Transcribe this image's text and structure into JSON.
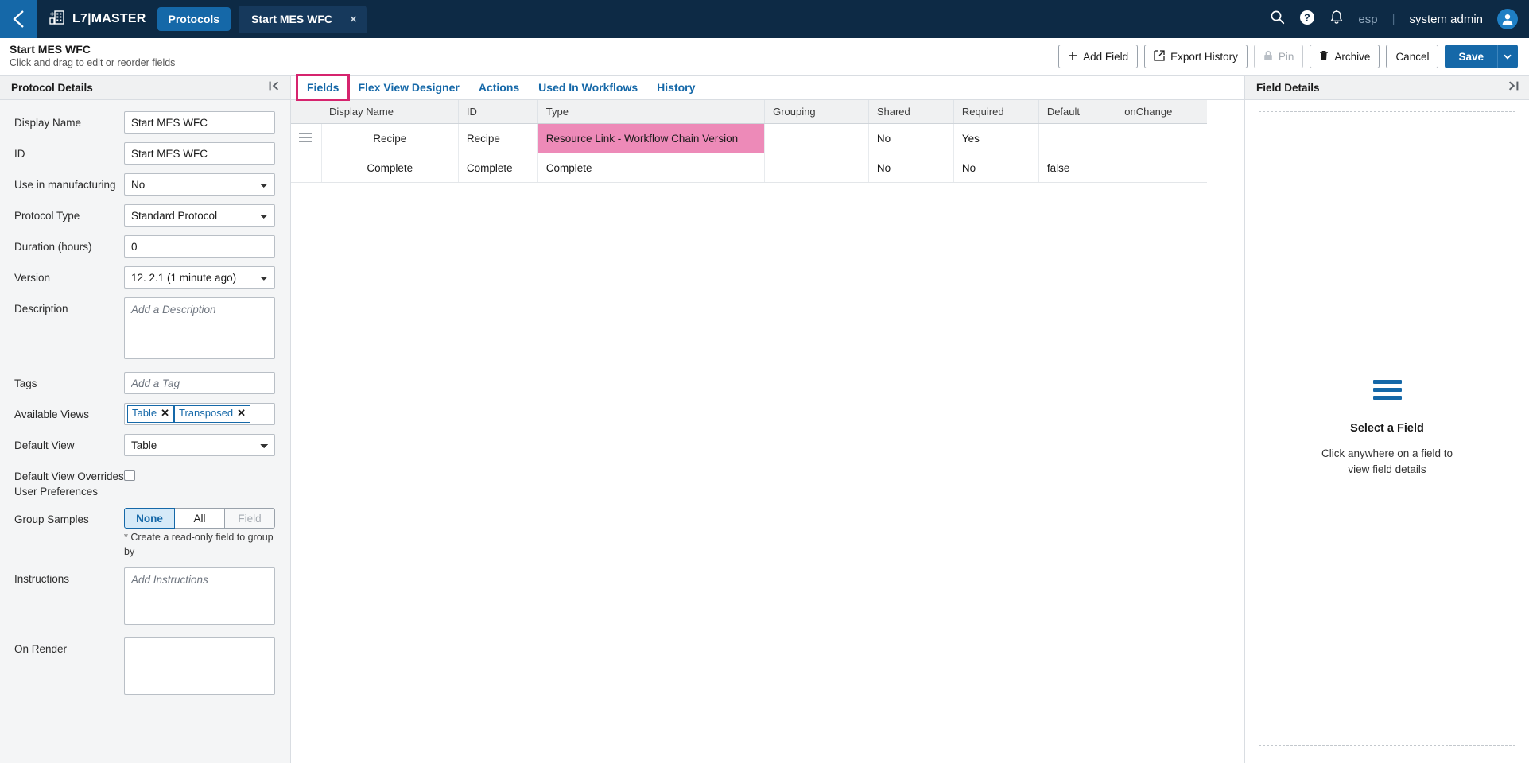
{
  "topbar": {
    "back_icon": "chevron-left-icon",
    "brand_icon": "building-add-icon",
    "brand_label": "L7|MASTER",
    "nav_pill_label": "Protocols",
    "open_tab_label": "Start MES WFC",
    "open_tab_close": "×",
    "search_icon": "search-icon",
    "help_icon": "help-circle-icon",
    "notifications_icon": "bell-icon",
    "org_label": "esp",
    "divider": "|",
    "user_name": "system admin",
    "avatar_icon": "user-avatar-icon"
  },
  "pagehead": {
    "title": "Start MES WFC",
    "subtitle": "Click and drag to edit or reorder fields",
    "actions": [
      {
        "label": "Add Field",
        "icon": "plus-icon",
        "disabled": false
      },
      {
        "label": "Export History",
        "icon": "external-link-icon",
        "disabled": false
      },
      {
        "label": "Pin",
        "icon": "lock-icon",
        "disabled": true
      },
      {
        "label": "Archive",
        "icon": "trash-icon",
        "disabled": false
      },
      {
        "label": "Cancel",
        "icon": "",
        "disabled": false
      }
    ],
    "save_label": "Save",
    "save_caret_icon": "chevron-down-icon"
  },
  "sidebar": {
    "panel_title": "Protocol Details",
    "collapse_icon": "collapse-left-icon",
    "fields": {
      "display_name": {
        "label": "Display Name",
        "value": "Start MES WFC"
      },
      "id": {
        "label": "ID",
        "value": "Start MES WFC"
      },
      "use_in_manufacturing": {
        "label": "Use in manufacturing",
        "value": "No"
      },
      "protocol_type": {
        "label": "Protocol Type",
        "value": "Standard Protocol"
      },
      "duration": {
        "label": "Duration (hours)",
        "value": "0"
      },
      "version": {
        "label": "Version",
        "value": "12. 2.1 (1 minute ago)"
      },
      "description": {
        "label": "Description",
        "value": "",
        "placeholder": "Add a Description"
      },
      "tags": {
        "label": "Tags",
        "value": "",
        "placeholder": "Add a Tag"
      },
      "available_views": {
        "label": "Available Views",
        "tags": [
          "Table",
          "Transposed"
        ],
        "remove_glyph": "✕"
      },
      "default_view": {
        "label": "Default View",
        "value": "Table"
      },
      "default_view_overrides": {
        "label": "Default View Overrides User Preferences",
        "checked": false
      },
      "group_samples": {
        "label": "Group Samples",
        "options": [
          "None",
          "All",
          "Field"
        ],
        "selected": "None",
        "disabled": [
          "Field"
        ],
        "hint": "* Create a read-only field to group by"
      },
      "instructions": {
        "label": "Instructions",
        "value": "",
        "placeholder": "Add Instructions"
      },
      "on_render": {
        "label": "On Render",
        "value": "",
        "placeholder": ""
      }
    }
  },
  "main": {
    "tabs": [
      {
        "label": "Fields",
        "highlighted": true
      },
      {
        "label": "Flex View Designer",
        "highlighted": false
      },
      {
        "label": "Actions",
        "highlighted": false
      },
      {
        "label": "Used In Workflows",
        "highlighted": false
      },
      {
        "label": "History",
        "highlighted": false
      }
    ],
    "table": {
      "columns": [
        "",
        "Display Name",
        "ID",
        "Type",
        "Grouping",
        "Shared",
        "Required",
        "Default",
        "onChange"
      ],
      "rows": [
        {
          "handle_icon": "drag-handle-icon",
          "has_handle": true,
          "display_name": "Recipe",
          "id": "Recipe",
          "type": "Resource Link - Workflow Chain Version",
          "type_highlighted": true,
          "grouping": "",
          "shared": "No",
          "required": "Yes",
          "default": "",
          "onchange": ""
        },
        {
          "handle_icon": "drag-handle-icon",
          "has_handle": false,
          "display_name": "Complete",
          "id": "Complete",
          "type": "Complete",
          "type_highlighted": false,
          "grouping": "",
          "shared": "No",
          "required": "No",
          "default": "false",
          "onchange": ""
        }
      ]
    }
  },
  "right_panel": {
    "panel_title": "Field Details",
    "collapse_icon": "collapse-right-icon",
    "empty_icon": "list-lines-icon",
    "empty_title": "Select a Field",
    "empty_subtitle": "Click anywhere on a field to view field details"
  },
  "colors": {
    "topbar_bg": "#0d2a45",
    "accent_blue": "#1568a8",
    "highlight_magenta": "#d6246e",
    "highlight_pink_cell": "#ed8ab8",
    "panel_bg": "#f4f5f6"
  }
}
